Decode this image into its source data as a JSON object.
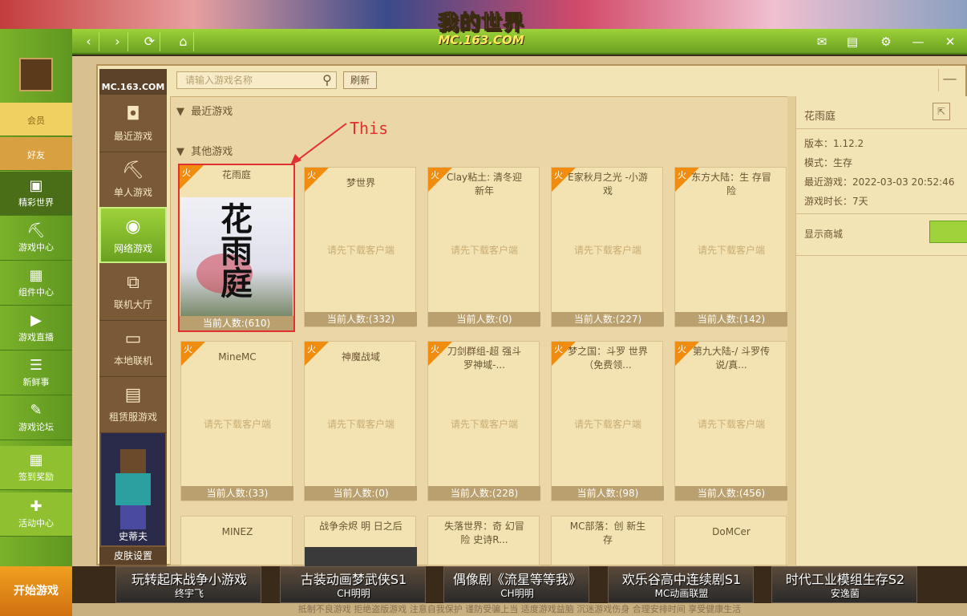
{
  "app": {
    "logo_main": "我的世界",
    "logo_sub": "MC.163.COM",
    "mc_logo": "MC.163.COM",
    "start_game": "开始游戏",
    "annotation": "This"
  },
  "left_nav": [
    {
      "label": "会员",
      "icon": "crown-icon"
    },
    {
      "label": "好友",
      "icon": "friends-icon"
    },
    {
      "label": "精彩世界",
      "icon": "world-icon"
    },
    {
      "label": "游戏中心",
      "icon": "pickaxe-icon"
    },
    {
      "label": "组件中心",
      "icon": "component-icon"
    },
    {
      "label": "游戏直播",
      "icon": "play-icon"
    },
    {
      "label": "新鲜事",
      "icon": "news-icon"
    },
    {
      "label": "游戏论坛",
      "icon": "forum-icon"
    },
    {
      "label": "签到奖励",
      "icon": "calendar-icon"
    },
    {
      "label": "活动中心",
      "icon": "gift-icon"
    }
  ],
  "dialog_nav": [
    {
      "label": "最近游戏",
      "icon": "controller-icon"
    },
    {
      "label": "单人游戏",
      "icon": "pickaxe-icon"
    },
    {
      "label": "网络游戏",
      "icon": "globe-icon"
    },
    {
      "label": "联机大厅",
      "icon": "lan-icon"
    },
    {
      "label": "本地联机",
      "icon": "monitor-icon"
    },
    {
      "label": "租赁服游戏",
      "icon": "server-icon"
    }
  ],
  "player": {
    "name": "史蒂夫",
    "skin_settings": "皮肤设置"
  },
  "search": {
    "placeholder": "请输入游戏名称",
    "refresh": "刷新"
  },
  "sections": {
    "recent": "最近游戏",
    "other": "其他游戏"
  },
  "hot_badge": "火",
  "download_hint": "请先下载客户端",
  "games_row1": [
    {
      "title": "花雨庭",
      "count": "当前人数:(610)",
      "hot": true,
      "image": true
    },
    {
      "title": "梦世界",
      "count": "当前人数:(332)",
      "hot": true
    },
    {
      "title": "Clay粘土: 清冬迎新年",
      "count": "当前人数:(0)",
      "hot": true
    },
    {
      "title": "E家秋月之光 -小游戏",
      "count": "当前人数:(227)",
      "hot": true
    },
    {
      "title": "东方大陆：生 存冒险",
      "count": "当前人数:(142)",
      "hot": true
    }
  ],
  "games_row2": [
    {
      "title": "MineMC",
      "count": "当前人数:(33)",
      "hot": true
    },
    {
      "title": "神魔战域",
      "count": "当前人数:(0)",
      "hot": true
    },
    {
      "title": "刀剑群组-超 强斗罗神域-...",
      "count": "当前人数:(228)",
      "hot": true
    },
    {
      "title": "梦之国：斗罗 世界（免费领...",
      "count": "当前人数:(98)",
      "hot": true
    },
    {
      "title": "第九大陆-/ 斗罗传说/真...",
      "count": "当前人数:(456)",
      "hot": true
    }
  ],
  "games_row3": [
    {
      "title": "MINEZ"
    },
    {
      "title": "战争余烬 明 日之后"
    },
    {
      "title": "失落世界：奇 幻冒险 史诗R..."
    },
    {
      "title": "MC部落：创 新生存"
    },
    {
      "title": "DoMCer"
    }
  ],
  "image_text": "花雨庭",
  "info": {
    "name": "花雨庭",
    "version": "版本：1.12.2",
    "mode": "模式：生存",
    "recent": "最近游戏：2022-03-03 20:52:46",
    "duration": "游戏时长：7天",
    "show_store": "显示商城"
  },
  "banners": [
    {
      "title": "玩转起床战争小游戏",
      "author": "终宇飞"
    },
    {
      "title": "古装动画梦武侠S1",
      "author": "CH明明"
    },
    {
      "title": "偶像剧《流星等等我》",
      "author": "CH明明"
    },
    {
      "title": "欢乐谷高中连续剧S1",
      "author": "MC动画联盟"
    },
    {
      "title": "时代工业模组生存S2",
      "author": "安逸菌"
    }
  ],
  "footer": "抵制不良游戏 拒绝盗版游戏 注意自我保护 谨防受骗上当 适度游戏益脑 沉迷游戏伤身 合理安排时间 享受健康生活"
}
